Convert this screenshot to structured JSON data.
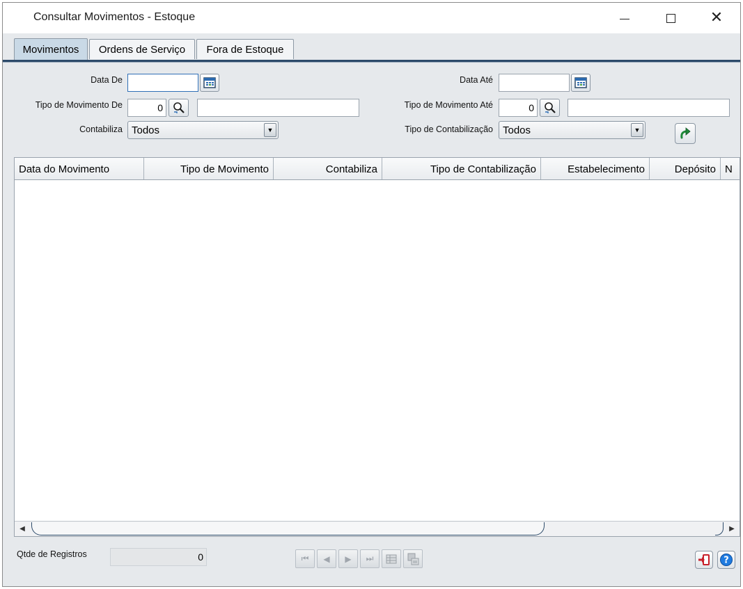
{
  "window": {
    "title": "Consultar Movimentos - Estoque"
  },
  "tabs": [
    {
      "label": "Movimentos",
      "active": true
    },
    {
      "label": "Ordens de Serviço",
      "active": false
    },
    {
      "label": "Fora de Estoque",
      "active": false
    }
  ],
  "filters": {
    "data_de_label": "Data De",
    "data_de_value": "",
    "data_ate_label": "Data Até",
    "data_ate_value": "",
    "tipo_mov_de_label": "Tipo de Movimento De",
    "tipo_mov_de_code": "0",
    "tipo_mov_de_desc": "",
    "tipo_mov_ate_label": "Tipo de Movimento Até",
    "tipo_mov_ate_code": "0",
    "tipo_mov_ate_desc": "",
    "contabiliza_label": "Contabiliza",
    "contabiliza_value": "Todos",
    "tipo_contab_label": "Tipo de Contabilização",
    "tipo_contab_value": "Todos"
  },
  "grid": {
    "columns": [
      {
        "label": "Data do Movimento",
        "align": "left"
      },
      {
        "label": "Tipo de Movimento",
        "align": "right"
      },
      {
        "label": "Contabiliza",
        "align": "right"
      },
      {
        "label": "Tipo de Contabilização",
        "align": "right"
      },
      {
        "label": "Estabelecimento",
        "align": "right"
      },
      {
        "label": "Depósito",
        "align": "right"
      },
      {
        "label": "N",
        "align": "left"
      }
    ],
    "rows": []
  },
  "footer": {
    "qtde_label": "Qtde de Registros",
    "qtde_value": "0"
  },
  "colors": {
    "accent": "#2c4a6a",
    "active_tab": "#c9d9e6",
    "focus_border": "#2f6fb6",
    "exit_icon": "#c8202a",
    "help_icon": "#1f7be0"
  }
}
